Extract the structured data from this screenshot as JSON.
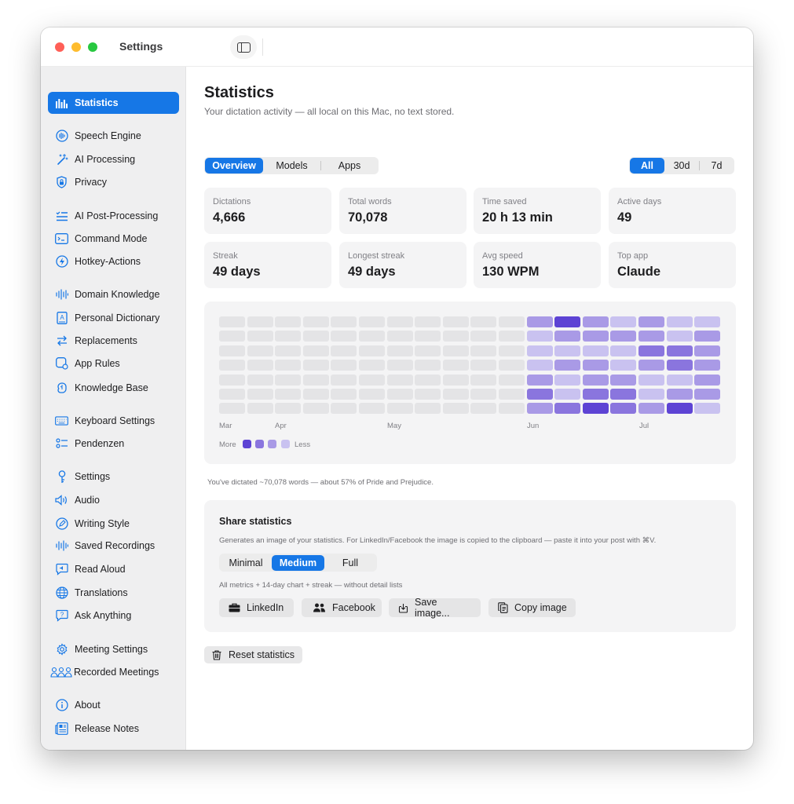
{
  "window": {
    "title": "Settings"
  },
  "sidebar": {
    "items": [
      {
        "label": "Statistics",
        "icon": "bar-chart-icon"
      },
      {
        "label": "Speech Engine",
        "icon": "waveform-circle-icon"
      },
      {
        "label": "AI Processing",
        "icon": "magic-wand-icon"
      },
      {
        "label": "Privacy",
        "icon": "lock-shield-icon"
      },
      {
        "label": "AI Post-Processing",
        "icon": "list-check-icon"
      },
      {
        "label": "Command Mode",
        "icon": "terminal-icon"
      },
      {
        "label": "Hotkey-Actions",
        "icon": "bolt-circle-icon"
      },
      {
        "label": "Domain Knowledge",
        "icon": "waveform-icon"
      },
      {
        "label": "Personal Dictionary",
        "icon": "dictionary-icon"
      },
      {
        "label": "Replacements",
        "icon": "swap-arrows-icon"
      },
      {
        "label": "App Rules",
        "icon": "app-rules-icon"
      },
      {
        "label": "Knowledge Base",
        "icon": "brain-icon"
      },
      {
        "label": "Keyboard Settings",
        "icon": "keyboard-icon"
      },
      {
        "label": "Pendenzen",
        "icon": "checklist-icon"
      },
      {
        "label": "Settings",
        "icon": "key-icon"
      },
      {
        "label": "Audio",
        "icon": "speaker-icon"
      },
      {
        "label": "Writing Style",
        "icon": "pencil-circle-icon"
      },
      {
        "label": "Saved Recordings",
        "icon": "waveform-icon"
      },
      {
        "label": "Read Aloud",
        "icon": "speech-bubble-icon"
      },
      {
        "label": "Translations",
        "icon": "globe-icon"
      },
      {
        "label": "Ask Anything",
        "icon": "question-bubble-icon"
      },
      {
        "label": "Meeting Settings",
        "icon": "gear-icon"
      },
      {
        "label": "Recorded Meetings",
        "icon": "people-icon"
      },
      {
        "label": "About",
        "icon": "info-icon"
      },
      {
        "label": "Release Notes",
        "icon": "newspaper-icon"
      }
    ]
  },
  "main": {
    "title": "Statistics",
    "subtitle": "Your dictation activity — all local on this Mac, no text stored.",
    "tabs": [
      {
        "label": "Overview",
        "selected": true
      },
      {
        "label": "Models",
        "selected": false
      },
      {
        "label": "Apps",
        "selected": false
      }
    ],
    "ranges": [
      {
        "label": "All",
        "selected": true
      },
      {
        "label": "30d",
        "selected": false
      },
      {
        "label": "7d",
        "selected": false
      }
    ],
    "stats": [
      {
        "label": "Dictations",
        "value": "4,666"
      },
      {
        "label": "Total words",
        "value": "70,078"
      },
      {
        "label": "Time saved",
        "value": "20 h 13 min"
      },
      {
        "label": "Active days",
        "value": "49"
      },
      {
        "label": "Streak",
        "value": "49 days"
      },
      {
        "label": "Longest streak",
        "value": "49 days"
      },
      {
        "label": "Avg speed",
        "value": "130 WPM"
      },
      {
        "label": "Top app",
        "value": "Claude"
      }
    ],
    "footnote": "You've dictated ~70,078 words — about 57% of Pride and Prejudice."
  },
  "heatmap": {
    "months": [
      "Mar",
      "Apr",
      "May",
      "Jun",
      "Jul"
    ],
    "legend_more": "More",
    "legend_less": "Less",
    "colors": [
      "#e4e4e6",
      "#c9c2f0",
      "#a99ae6",
      "#8a75de",
      "#5d43d4"
    ],
    "columns": 18,
    "rows": 7,
    "intensity": [
      [
        0,
        0,
        0,
        0,
        0,
        0,
        0,
        0,
        0,
        0,
        0,
        2,
        4,
        2,
        1,
        2,
        1,
        1
      ],
      [
        0,
        0,
        0,
        0,
        0,
        0,
        0,
        0,
        0,
        0,
        0,
        1,
        2,
        2,
        2,
        2,
        1,
        2
      ],
      [
        0,
        0,
        0,
        0,
        0,
        0,
        0,
        0,
        0,
        0,
        0,
        1,
        1,
        1,
        1,
        3,
        3,
        2
      ],
      [
        0,
        0,
        0,
        0,
        0,
        0,
        0,
        0,
        0,
        0,
        0,
        1,
        2,
        2,
        1,
        2,
        3,
        2
      ],
      [
        0,
        0,
        0,
        0,
        0,
        0,
        0,
        0,
        0,
        0,
        0,
        2,
        1,
        2,
        2,
        1,
        1,
        2
      ],
      [
        0,
        0,
        0,
        0,
        0,
        0,
        0,
        0,
        0,
        0,
        0,
        3,
        1,
        3,
        3,
        1,
        2,
        2
      ],
      [
        0,
        0,
        0,
        0,
        0,
        0,
        0,
        0,
        0,
        0,
        0,
        2,
        3,
        4,
        3,
        2,
        4,
        1
      ]
    ]
  },
  "share": {
    "title": "Share statistics",
    "description": "Generates an image of your statistics. For LinkedIn/Facebook the image is copied to the clipboard — paste it into your post with ⌘V.",
    "detail_options": [
      {
        "label": "Minimal",
        "selected": false
      },
      {
        "label": "Medium",
        "selected": true
      },
      {
        "label": "Full",
        "selected": false
      }
    ],
    "detail_note": "All metrics + 14-day chart + streak — without detail lists",
    "buttons": {
      "linkedin": "LinkedIn",
      "facebook": "Facebook",
      "save": "Save image...",
      "copy": "Copy image"
    }
  },
  "reset_label": "Reset statistics"
}
